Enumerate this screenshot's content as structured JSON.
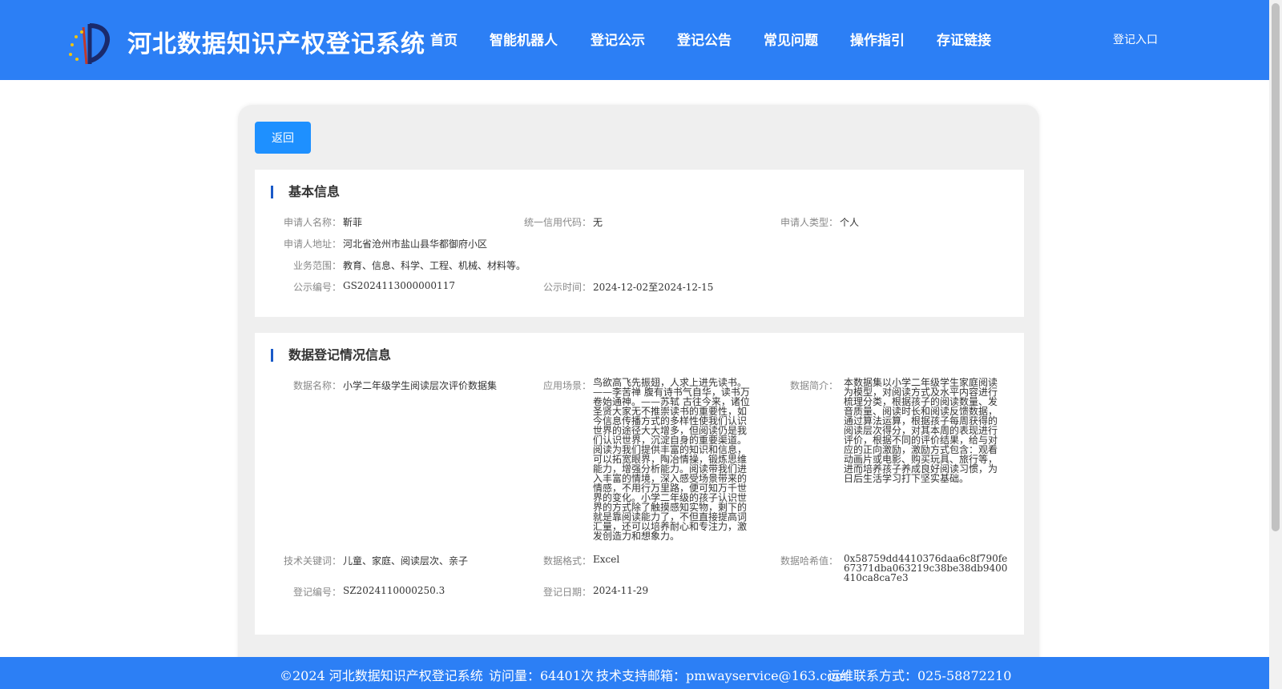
{
  "header": {
    "site_title": "河北数据知识产权登记系统",
    "nav": [
      "首页",
      "智能机器人",
      "登记公示",
      "登记公告",
      "常见问题",
      "操作指引",
      "存证链接"
    ],
    "login": "登记入口"
  },
  "back_label": "返回",
  "basic": {
    "title": "基本信息",
    "applicant_name_label": "申请人名称：",
    "applicant_name": "靳菲",
    "credit_code_label": "统一信用代码：",
    "credit_code": "无",
    "applicant_type_label": "申请人类型：",
    "applicant_type": "个人",
    "address_label": "申请人地址：",
    "address": "河北省沧州市盐山县华都御府小区",
    "scope_label": "业务范围：",
    "scope": "教育、信息、科学、工程、机械、材料等。",
    "notice_no_label": "公示编号：",
    "notice_no": "GS2024113000000117",
    "notice_time_label": "公示时间：",
    "notice_time": "2024-12-02至2024-12-15"
  },
  "data_info": {
    "title": "数据登记情况信息",
    "data_name_label": "数据名称：",
    "data_name": "小学二年级学生阅读层次评价数据集",
    "scene_label": "应用场景：",
    "scene": "鸟欲高飞先振翅，人求上进先读书。——李苦禅 腹有诗书气自华，读书万卷始通神。——苏轼 古往今来，诸位圣贤大家无不推崇读书的重要性，如今信息传播方式的多样性使我们认识世界的途径大大增多，但阅读仍是我们认识世界，沉淀自身的重要渠道。阅读为我们提供丰富的知识和信息，可以拓宽眼界，陶冶情操，锻炼思维能力，增强分析能力。阅读带我们进入丰富的情境，深入感受场景带来的情感，不用行万里路，便可知万千世界的变化。小学二年级的孩子认识世界的方式除了触摸感知实物，剩下的就是靠阅读能力了，不但直接提高词汇量，还可以培养耐心和专注力，激发创造力和想象力。",
    "intro_label": "数据简介：",
    "intro": "本数据集以小学二年级学生家庭阅读为模型，对阅读方式及水平内容进行梳理分类，根据孩子的阅读数量、发音质量、阅读时长和阅读反馈数据，通过算法运算，根据孩子每周获得的阅读层次得分，对其本周的表现进行评价，根据不同的评价结果，给与对应的正向激励，激励方式包含：观看动画片或电影、购买玩具、旅行等，进而培养孩子养成良好阅读习惯，为日后生活学习打下坚实基础。",
    "keywords_label": "技术关键词：",
    "keywords": "儿童、家庭、阅读层次、亲子",
    "format_label": "数据格式：",
    "format": "Excel",
    "hash_label": "数据哈希值：",
    "hash": "0x58759dd4410376daa6c8f790fe67371dba063219c38be38db9400410ca8ca7e3",
    "reg_no_label": "登记编号：",
    "reg_no": "SZ2024110000250.3",
    "reg_date_label": "登记日期：",
    "reg_date": "2024-11-29"
  },
  "footer": {
    "copyright": "©2024 河北数据知识产权登记系统",
    "visits": "访问量：64401次",
    "email": "技术支持邮箱：pmwayservice@163.com",
    "contact": "运维联系方式：025-58872210"
  },
  "colors": {
    "header_bg": "#2c7ff5",
    "button_bg": "#1e90ff",
    "accent_bar": "#1a5ac8"
  }
}
